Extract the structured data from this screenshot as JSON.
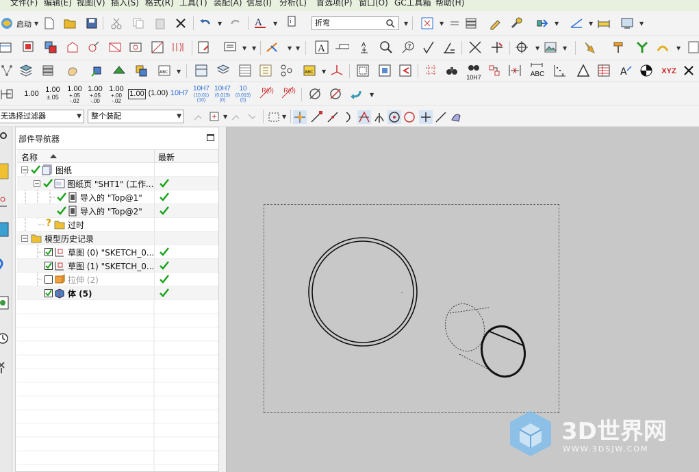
{
  "menu": [
    "文件(F)",
    "编辑(E)",
    "视图(V)",
    "插入(S)",
    "格式(R)",
    "工具(T)",
    "装配(A)",
    "信息(I)",
    "分析(L)",
    "首选项(P)",
    "窗口(O)",
    "GC工具箱",
    "帮助(H)"
  ],
  "toolbar": {
    "start_label": "启动",
    "search_value": "折弯",
    "filter_value": "无选择过滤器",
    "scope_value": "整个装配",
    "dims": {
      "d1": "1.00",
      "d2_main": "1.00",
      "d2_tol": "±.05",
      "d3_main": "1.00",
      "d3_up": "+.05",
      "d3_lo": "-.02",
      "d4_main": "1.00",
      "d4_up": "+.05",
      "d4_lo": "-.00",
      "d5_main": "1.00",
      "d5_up": "+.00",
      "d5_lo": "-.02",
      "d6": "1.00",
      "d7": "(1.00)",
      "d8": "10H7",
      "d9_main": "10H7",
      "d9_sub": "(10.01)",
      "d9_sub2": "(10)",
      "d10_main": "10H7",
      "d10_sub": "(0.019)",
      "d10_sub2": "(0)",
      "d11_main": "10",
      "d11_sub": "(0.019)",
      "d11_sub2": "(0)",
      "r1": "R(0)",
      "r2": "R(0)",
      "h7": "10H7",
      "abc": "ABC",
      "xyz": "XYZ"
    }
  },
  "navigator": {
    "title": "部件导航器",
    "col_name": "名称",
    "col_latest": "最新",
    "rows": {
      "r0": "图纸",
      "r1": "图纸页 \"SHT1\" (工作...",
      "r2": "导入的 \"Top@1\"",
      "r3": "导入的 \"Top@2\"",
      "r4": "过时",
      "r5": "模型历史记录",
      "r6": "草图 (0) \"SKETCH_0...",
      "r7": "草图 (1) \"SKETCH_0...",
      "r8": "拉伸 (2)",
      "r9": "体 (5)"
    }
  },
  "watermark": {
    "title": "3D世界网",
    "url": "WWW.3DSJW.COM"
  },
  "colors": {
    "check": "#19a319",
    "canvas": "#c8c8c8",
    "accent": "#2a6fd6"
  }
}
